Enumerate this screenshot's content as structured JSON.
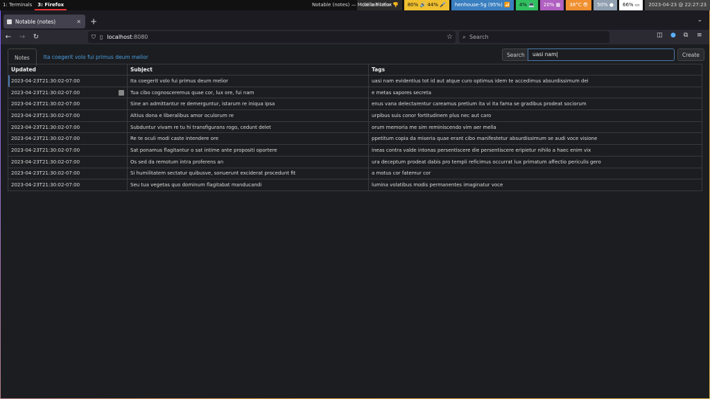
{
  "swaybar": {
    "workspaces": [
      "1: Terminals",
      "3: Firefox"
    ],
    "window_title": "Notable (notes) — Mozilla Firefox",
    "blocks": [
      {
        "text": "Idle inhibitor 👎",
        "color": "#2b2b2b",
        "fg": "#ddd"
      },
      {
        "text": "80% 🔊 44% 🎤",
        "color": "#f0c030",
        "fg": "#111"
      },
      {
        "text": "henhouse-5g (95%) 📶",
        "color": "#3a7fc0",
        "fg": "#fff"
      },
      {
        "text": "4% 💻",
        "color": "#30c060",
        "fg": "#111"
      },
      {
        "text": "20% ▦",
        "color": "#b060c0",
        "fg": "#fff"
      },
      {
        "text": "38°C 😎",
        "color": "#f09030",
        "fg": "#fff"
      },
      {
        "text": "50% ●",
        "color": "#90a0b0",
        "fg": "#fff"
      },
      {
        "text": "66% ▭",
        "color": "#ffffff",
        "fg": "#111"
      },
      {
        "text": "2023-04-23 @ 22:27:23",
        "color": "#444",
        "fg": "#ddd"
      }
    ]
  },
  "browser": {
    "tab_title": "Notable (notes)",
    "url_host": "localhost",
    "url_port": ":8080",
    "search_placeholder": "Search"
  },
  "app": {
    "tab_notes": "Notes",
    "open_note": "Ita coegerit volo fui primus deum melior",
    "search_label": "Search",
    "search_value": "uasi nam|",
    "create_label": "Create",
    "columns": [
      "Updated",
      "Subject",
      "Tags"
    ],
    "rows": [
      {
        "updated": "2023-04-23T21:30:02-07:00",
        "subject": "Ita coegerit volo fui primus deum melior",
        "tags": "uasi nam evidentius tot id aut atque curo optimus idem te accedimus absurdissimum dei"
      },
      {
        "updated": "2023-04-23T21:30:02-07:00",
        "subject": "Tua cibo cognosceremus quae cor, lux ore, fui nam",
        "tags": "e metas sapores secreta"
      },
      {
        "updated": "2023-04-23T21:30:02-07:00",
        "subject": "Sine an admittantur re demerguntur, istarum re iniqua ipsa",
        "tags": "enus vana delectarentur careamus pretium ita vi ita fama se gradibus prodeat sociorum"
      },
      {
        "updated": "2023-04-23T21:30:02-07:00",
        "subject": "Altius dona e liberalibus amor oculorum re",
        "tags": "urpibus suis conor fortitudinem plus nec aut caro"
      },
      {
        "updated": "2023-04-23T21:30:02-07:00",
        "subject": "Subduntur vivam re tu hi transfigurans rogo, cedunt delet",
        "tags": "orum memoria me sim reminiscendo vim aer mella"
      },
      {
        "updated": "2023-04-23T21:30:02-07:00",
        "subject": "Re te oculi modi caste intendere ore",
        "tags": "ppetitum copia da miseria quae erant cibo manifestetur absurdissimum se audi voce visione"
      },
      {
        "updated": "2023-04-23T21:30:02-07:00",
        "subject": "Sat ponamus flagitantur o sat intime ante propositi oportere",
        "tags": "ineas contra valde intonas persentiscere die persentiscere eripietur nihilo a haec enim vix"
      },
      {
        "updated": "2023-04-23T21:30:02-07:00",
        "subject": "Os sed da remotum intra proferens an",
        "tags": "ura deceptum prodeat dabis pro templi reficimus occurrat lux primatum affectio periculis gero"
      },
      {
        "updated": "2023-04-23T21:30:02-07:00",
        "subject": "Si humilitatem sectatur quibusve, sonuerunt exciderat procedunt fit",
        "tags": "a motus cor fatemur cor"
      },
      {
        "updated": "2023-04-23T21:30:02-07:00",
        "subject": "Seu tua vegetas quo dominum flagitabat manducandi",
        "tags": "lumina volatibus modis permanentes imaginatur voce"
      }
    ]
  }
}
